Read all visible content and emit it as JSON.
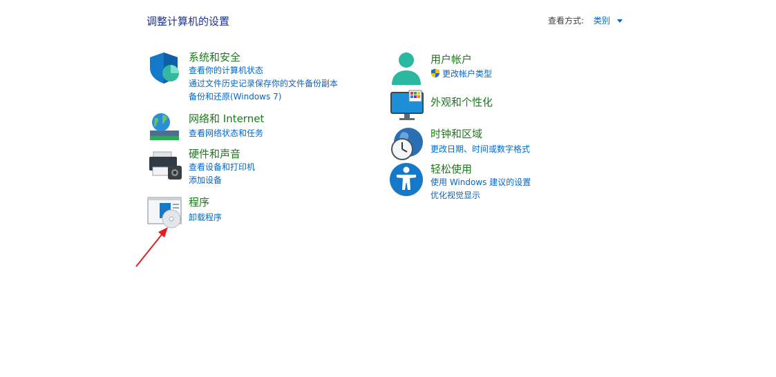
{
  "header": {
    "title": "调整计算机的设置",
    "view_by_label": "查看方式:",
    "view_by_value": "类别"
  },
  "left": {
    "system_security": {
      "title": "系统和安全",
      "links": [
        "查看你的计算机状态",
        "通过文件历史记录保存你的文件备份副本",
        "备份和还原(Windows 7)"
      ],
      "icon": "shield-icon"
    },
    "network": {
      "title": "网络和 Internet",
      "links": [
        "查看网络状态和任务"
      ],
      "icon": "network-globe-icon"
    },
    "hardware": {
      "title": "硬件和声音",
      "links": [
        "查看设备和打印机",
        "添加设备"
      ],
      "icon": "printer-icon"
    },
    "programs": {
      "title": "程序",
      "links": [
        "卸载程序"
      ],
      "icon": "programs-disc-icon"
    }
  },
  "right": {
    "user_accounts": {
      "title": "用户帐户",
      "links": [
        "更改帐户类型"
      ],
      "icon": "user-icon"
    },
    "appearance": {
      "title": "外观和个性化",
      "links": [],
      "icon": "monitor-icon"
    },
    "clock_region": {
      "title": "时钟和区域",
      "links": [
        "更改日期、时间或数字格式"
      ],
      "icon": "clock-globe-icon"
    },
    "ease_access": {
      "title": "轻松使用",
      "links": [
        "使用 Windows 建议的设置",
        "优化视觉显示"
      ],
      "icon": "accessibility-icon"
    }
  },
  "colors": {
    "category_title": "#1a7a1a",
    "link": "#0066cc",
    "page_title": "#1e3287",
    "annotation_arrow": "#e02020"
  }
}
